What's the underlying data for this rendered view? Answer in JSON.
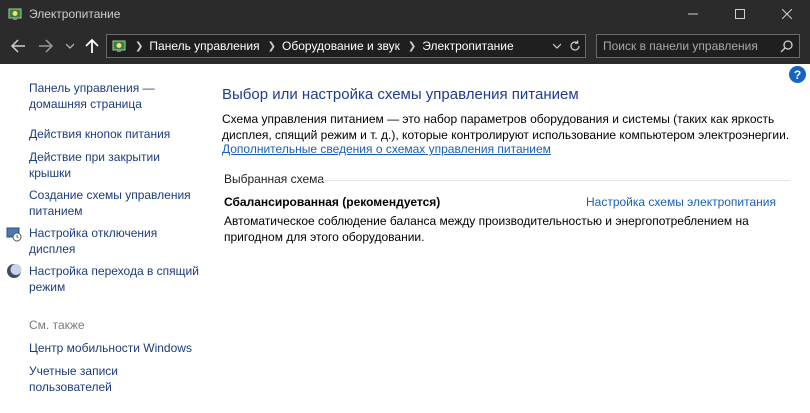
{
  "window": {
    "title": "Электропитание"
  },
  "navigation": {
    "breadcrumbs": [
      "Панель управления",
      "Оборудование и звук",
      "Электропитание"
    ]
  },
  "search": {
    "placeholder": "Поиск в панели управления"
  },
  "sidebar": {
    "home_link": "Панель управления — домашняя страница",
    "items": [
      {
        "label": "Действия кнопок питания",
        "icon": ""
      },
      {
        "label": "Действие при закрытии крышки",
        "icon": ""
      },
      {
        "label": "Создание схемы управления питанием",
        "icon": ""
      },
      {
        "label": "Настройка отключения дисплея",
        "icon": "display-power-icon"
      },
      {
        "label": "Настройка перехода в спящий режим",
        "icon": "sleep-moon-icon"
      }
    ],
    "see_also_label": "См. также",
    "see_also": [
      {
        "label": "Центр мобильности Windows"
      },
      {
        "label": "Учетные записи пользователей"
      }
    ]
  },
  "main": {
    "title": "Выбор или настройка схемы управления питанием",
    "description": "Схема управления питанием — это набор параметров оборудования и системы (таких как яркость дисплея, спящий режим и т. д.), которые контролируют использование компьютером электроэнергии.",
    "more_info_link": "Дополнительные сведения о схемах управления питанием",
    "selected_plan_label": "Выбранная схема",
    "plan": {
      "name": "Сбалансированная (рекомендуется)",
      "settings_link": "Настройка схемы электропитания",
      "description": "Автоматическое соблюдение баланса между производительностью и энергопотреблением на пригодном для этого оборудовании."
    },
    "help_label": "?"
  },
  "colors": {
    "titlebar_bg": "#2b2b2b",
    "link": "#1a5fb4",
    "title_blue": "#1e3d8f"
  }
}
